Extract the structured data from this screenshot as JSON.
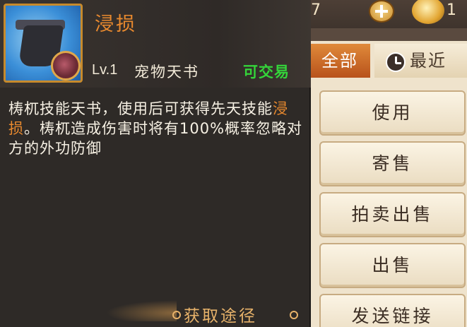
{
  "topbar": {
    "counter": "7",
    "plus_icon": "plus-icon",
    "gold_icon": "gold-ingot-icon",
    "gold_count": "1"
  },
  "tabs": [
    {
      "label": "全部",
      "active": true
    },
    {
      "label": "最近",
      "icon": "clock-icon",
      "active": false
    }
  ],
  "item": {
    "name": "浸损",
    "level": "Lv.1",
    "type": "宠物天书",
    "tradable": "可交易",
    "description_parts": [
      {
        "text": "梼杌技能天书，使用后可获得先天技能",
        "highlight": false
      },
      {
        "text": "浸损",
        "highlight": true
      },
      {
        "text": "。梼杌造成伤害时将有100%概率忽略对方的外功防御",
        "highlight": false
      }
    ],
    "acquire_label": "获取途径"
  },
  "actions": [
    "使用",
    "寄售",
    "拍卖出售",
    "出售",
    "发送链接"
  ],
  "colors": {
    "name": "#e8892e",
    "tradable": "#34d43a",
    "tab_active": "#c8621f",
    "acquire": "#e7b26a"
  }
}
